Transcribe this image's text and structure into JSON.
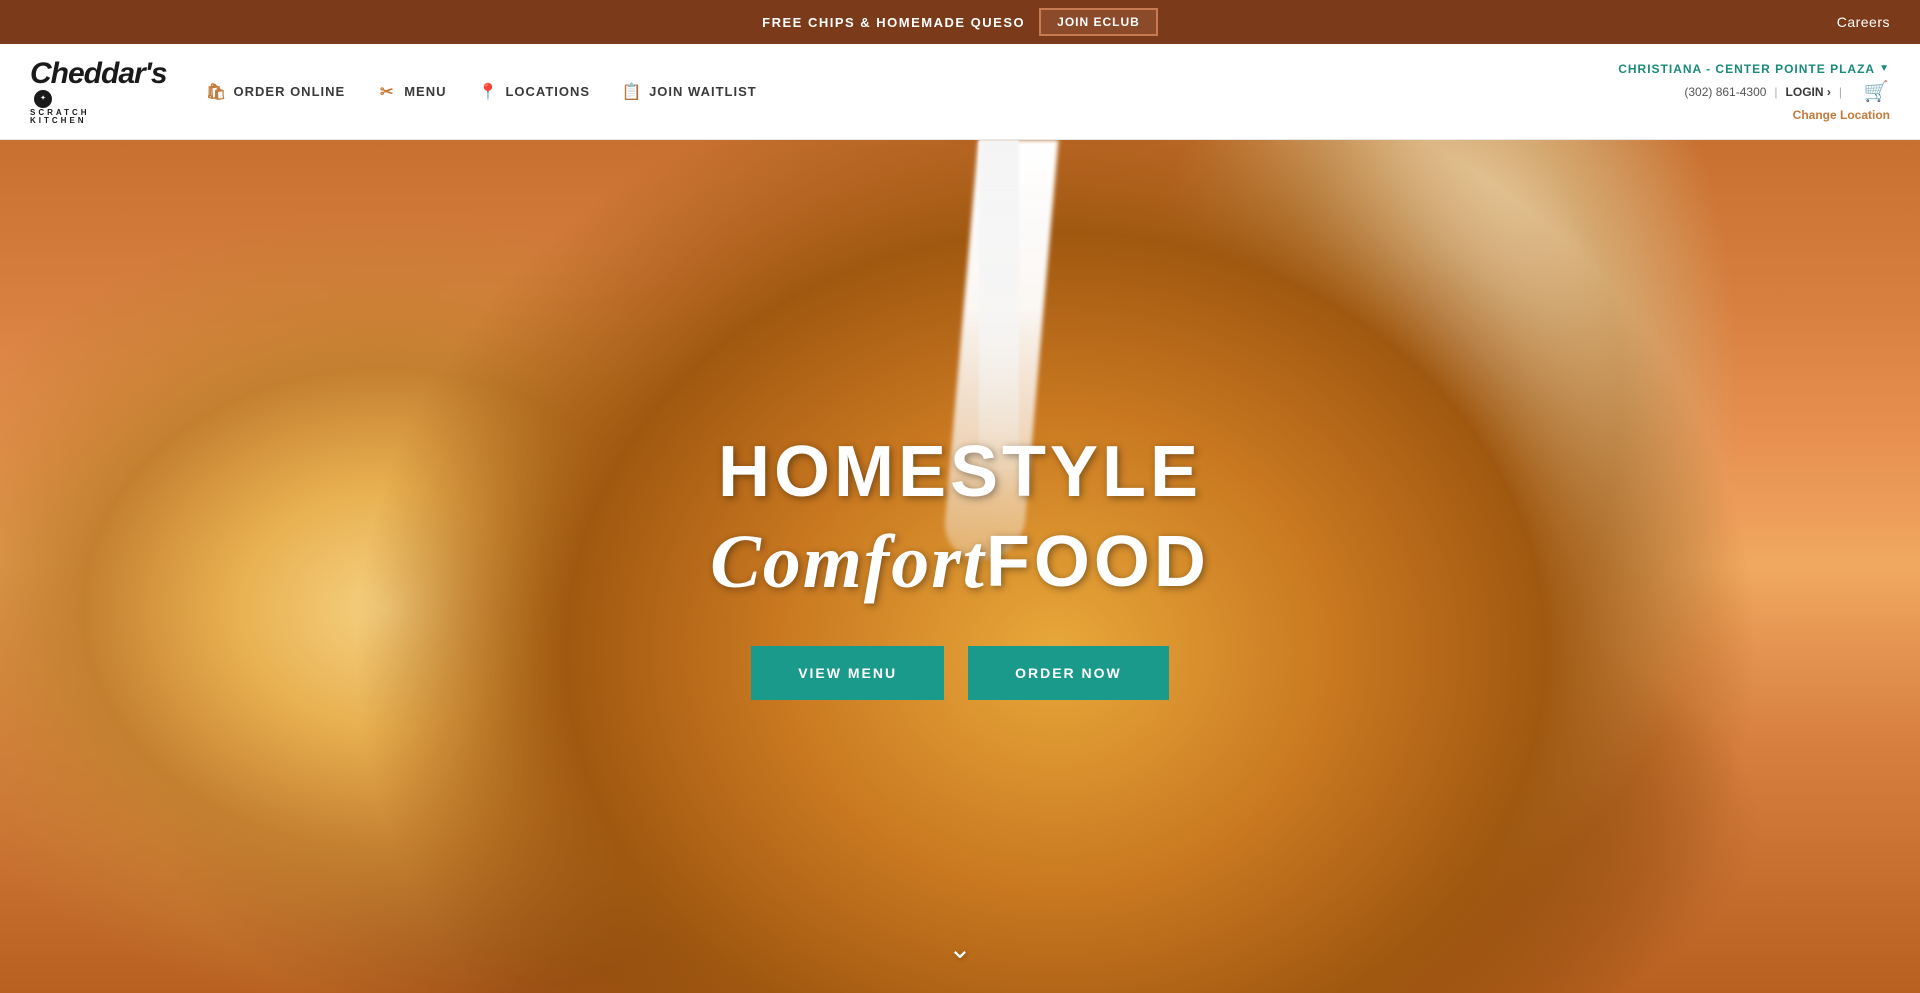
{
  "topBanner": {
    "promoText": "FREE CHIPS & HOMEMADE QUESO",
    "eclubLabel": "JOIN ECLUB",
    "careersLabel": "Careers"
  },
  "navbar": {
    "logoTop": "Cheddar's",
    "logoScratch": "SCRATCH",
    "logoKitchen": "KITCHEN",
    "orderOnlineLabel": "ORDER ONLINE",
    "menuLabel": "MENU",
    "locationsLabel": "LOCATIONS",
    "joinWaitlistLabel": "JOIN WAITLIST",
    "locationName": "CHRISTIANA - CENTER POINTE PLAZA",
    "locationPhone": "(302) 861-4300",
    "loginLabel": "LOGIN ›",
    "changeLocationLabel": "Change Location"
  },
  "hero": {
    "titleTop": "HOMESTYLE",
    "titleComfort": "Comfort",
    "titleFood": "FOOD",
    "viewMenuLabel": "VIEW MENU",
    "orderNowLabel": "ORDER NOW"
  },
  "colors": {
    "teal": "#1A9A8A",
    "orange": "#C47A3A",
    "brown": "#7B3A1A",
    "dark": "#2a2a2a",
    "white": "#ffffff"
  }
}
